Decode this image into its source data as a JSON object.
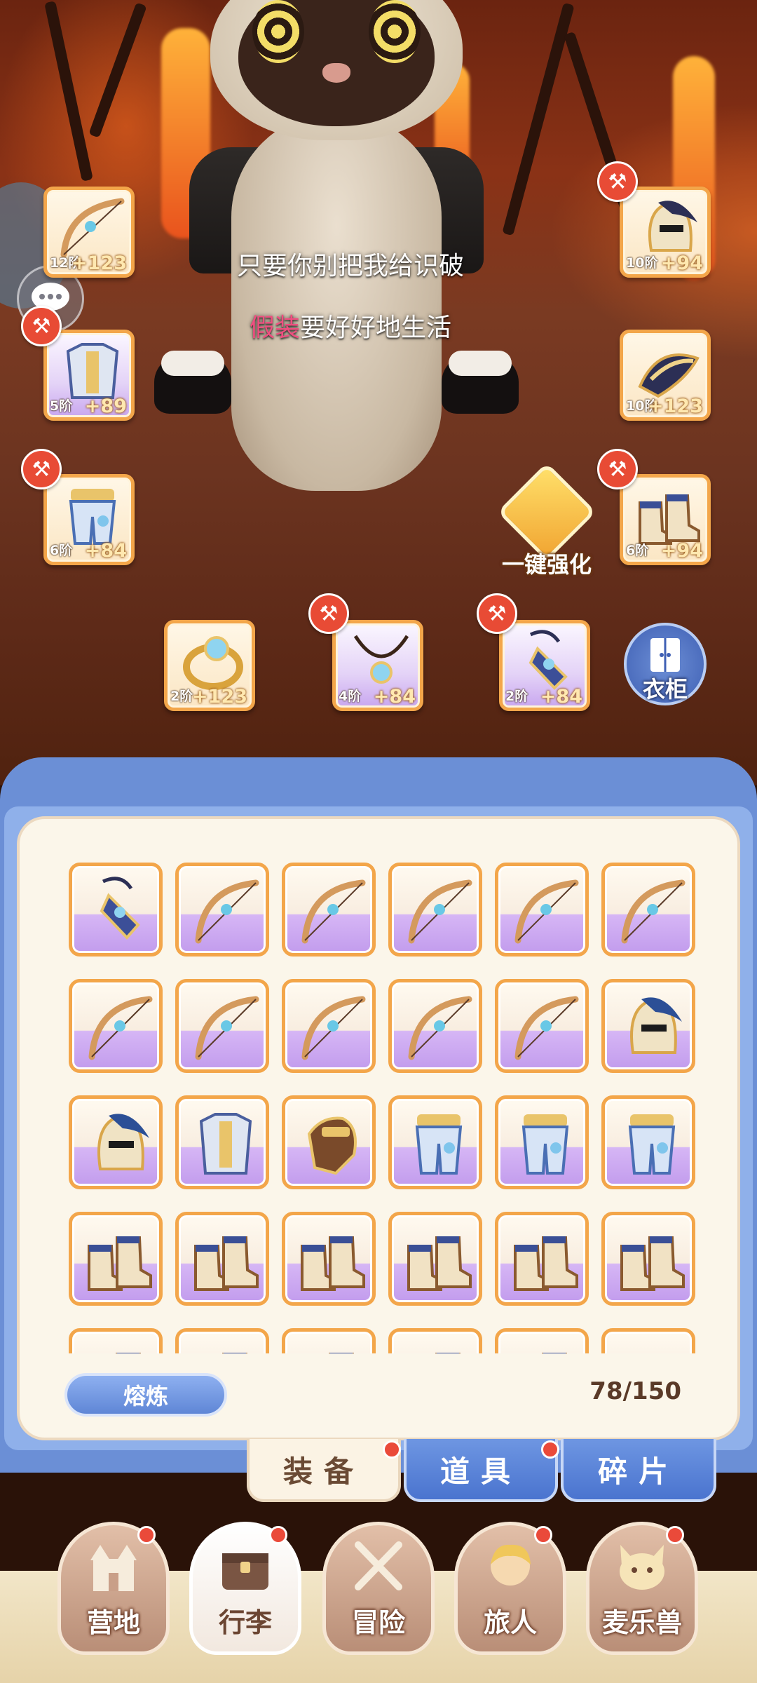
{
  "subtitles": {
    "line1": "只要你别把我给识破",
    "line2_highlight": "假装",
    "line2_rest": "要好好地生活"
  },
  "equipped": {
    "bow": {
      "tier": "12阶",
      "level": "+123"
    },
    "helmet": {
      "tier": "10阶",
      "level": "+94"
    },
    "armor": {
      "tier": "5阶",
      "level": "+89"
    },
    "headpiece": {
      "tier": "10阶",
      "level": "+123"
    },
    "pants": {
      "tier": "6阶",
      "level": "+84"
    },
    "boots": {
      "tier": "6阶",
      "level": "+94"
    },
    "ring": {
      "tier": "2阶",
      "level": "+123"
    },
    "necklace": {
      "tier": "4阶",
      "level": "+84"
    },
    "amulet": {
      "tier": "2阶",
      "level": "+84"
    }
  },
  "enhance_all_label": "一键强化",
  "wardrobe_label": "衣柜",
  "inventory": {
    "smelt_label": "熔炼",
    "capacity": "78/150",
    "rows": [
      [
        "amulet-icon",
        "bow-icon",
        "bow-icon",
        "bow-icon",
        "bow-icon",
        "bow-icon"
      ],
      [
        "bow-icon",
        "bow-icon",
        "bow-icon",
        "bow-icon",
        "bow-icon",
        "helmet-icon"
      ],
      [
        "helmet-icon",
        "armor-icon",
        "gauntlet-icon",
        "pants-icon",
        "pants-icon",
        "pants-icon"
      ],
      [
        "boots-icon",
        "boots-icon",
        "boots-icon",
        "boots-icon",
        "boots-icon",
        "boots-icon"
      ],
      [
        "boots-icon",
        "boots-icon",
        "boots-icon",
        "boots-icon",
        "boots-icon",
        "orb-icon"
      ]
    ]
  },
  "tabs": [
    {
      "label": "装备",
      "active": true
    },
    {
      "label": "道具",
      "active": false
    },
    {
      "label": "碎片",
      "active": false
    }
  ],
  "nav": [
    {
      "label": "营地",
      "icon": "castle-icon"
    },
    {
      "label": "行李",
      "icon": "chest-icon"
    },
    {
      "label": "冒险",
      "icon": "swords-icon"
    },
    {
      "label": "旅人",
      "icon": "traveler-icon"
    },
    {
      "label": "麦乐兽",
      "icon": "cat-icon"
    }
  ],
  "colors": {
    "accent_orange": "#f3a64a",
    "panel_blue": "#6b8fd6",
    "badge_red": "#ea4a3a",
    "highlight_pink": "#ef4f80"
  }
}
